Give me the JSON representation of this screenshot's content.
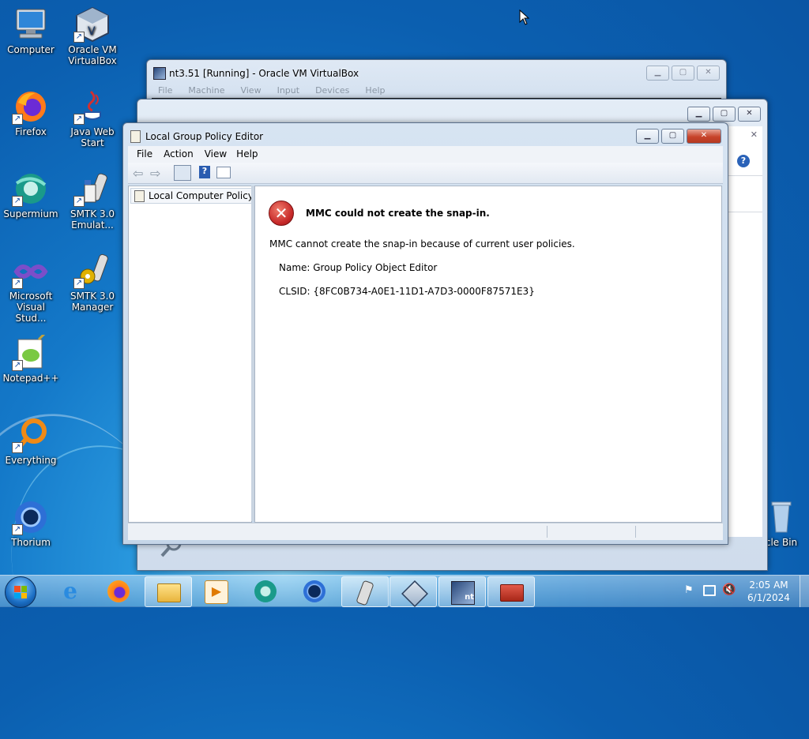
{
  "desktop": {
    "icons": [
      {
        "label": "Computer"
      },
      {
        "label": "Oracle VM VirtualBox"
      },
      {
        "label": "Firefox"
      },
      {
        "label": "Java Web Start"
      },
      {
        "label": "Supermium"
      },
      {
        "label": "SMTK 3.0 Emulat..."
      },
      {
        "label": "Microsoft Visual Stud..."
      },
      {
        "label": "SMTK 3.0 Manager"
      },
      {
        "label": "Notepad++"
      },
      {
        "label": "Everything"
      },
      {
        "label": "Thorium"
      },
      {
        "label": "cle Bin"
      }
    ]
  },
  "vbox_window": {
    "title": "nt3.51 [Running] - Oracle VM VirtualBox",
    "menu": [
      "File",
      "Machine",
      "View",
      "Input",
      "Devices",
      "Help"
    ]
  },
  "mmc_window": {
    "title": "Local Group Policy Editor",
    "menu": [
      "File",
      "Action",
      "View",
      "Help"
    ],
    "tree_root": "Local Computer Policy",
    "error": {
      "heading": "MMC could not create the snap-in.",
      "message": "MMC cannot create the snap-in because of current user policies.",
      "name_line": "Name: Group Policy Object Editor",
      "clsid_line": "CLSID: {8FC0B734-A0E1-11D1-A7D3-0000F87571E3}"
    }
  },
  "taskbar": {
    "clock_time": "2:05 AM",
    "clock_date": "6/1/2024",
    "buttons": [
      "Internet Explorer",
      "Firefox",
      "Windows Explorer",
      "Media Player",
      "Supermium",
      "Thorium",
      "SMTK",
      "VirtualBox",
      "nt3.51",
      "Toolbox"
    ]
  },
  "colors": {
    "error_red": "#c62828",
    "title_glass": "#dfe9f5",
    "desktop_blue": "#1479c9"
  }
}
